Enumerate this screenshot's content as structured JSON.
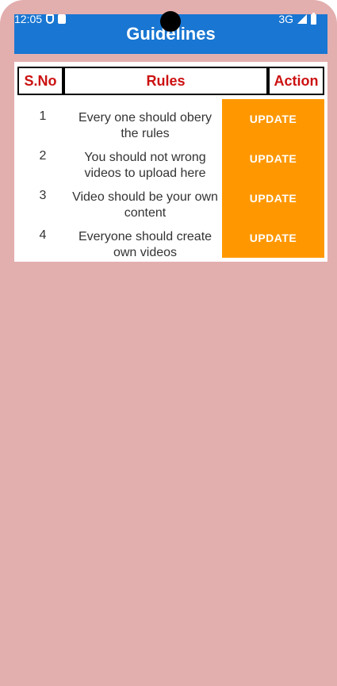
{
  "status_bar": {
    "time": "12:05",
    "network": "3G"
  },
  "app_bar": {
    "title": "Guidelines",
    "color": "#1976d2"
  },
  "table": {
    "headers": [
      "S.No",
      "Rules",
      "Action"
    ],
    "rows": [
      {
        "sno": "1",
        "rule": "Every one should obery the rules",
        "action": "UPDATE"
      },
      {
        "sno": "2",
        "rule": "You should not wrong videos to upload here",
        "action": "UPDATE"
      },
      {
        "sno": "3",
        "rule": "Video should be your own content",
        "action": "UPDATE"
      },
      {
        "sno": "4",
        "rule": "Everyone should create own videos",
        "action": "UPDATE"
      }
    ],
    "header_color": "#cc1111",
    "action_color": "#ff9800"
  },
  "background_color": "#e3aeae",
  "icons": [
    "shield-icon",
    "sd-card-icon",
    "signal-icon",
    "battery-icon"
  ]
}
